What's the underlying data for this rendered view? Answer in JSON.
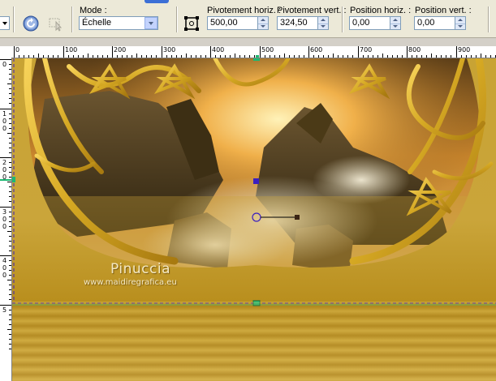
{
  "toolbar": {
    "mode_label": "Mode :",
    "mode_value": "Échelle",
    "pivot_h_label": "Pivotement horiz. :",
    "pivot_h_value": "500,00",
    "pivot_v_label": "Pivotement vert. :",
    "pivot_v_value": "324,50",
    "pos_h_label": "Position horiz. :",
    "pos_h_value": "0,00",
    "pos_v_label": "Position vert. :",
    "pos_v_value": "0,00"
  },
  "ruler": {
    "h_labels": [
      "0",
      "100",
      "200",
      "300",
      "400",
      "500",
      "600",
      "700",
      "800",
      "900"
    ],
    "v_labels": [
      "0",
      "1\n0\n0",
      "2\n0\n0",
      "3\n0\n0",
      "4\n0\n0",
      "5"
    ]
  },
  "canvas": {
    "watermark_title": "Pinuccia",
    "watermark_url": "www.maidiregrafica.eu"
  },
  "colors": {
    "handle_blue": "#3b1fbf",
    "guide_green": "#1db872",
    "gold": "#d5a823"
  }
}
